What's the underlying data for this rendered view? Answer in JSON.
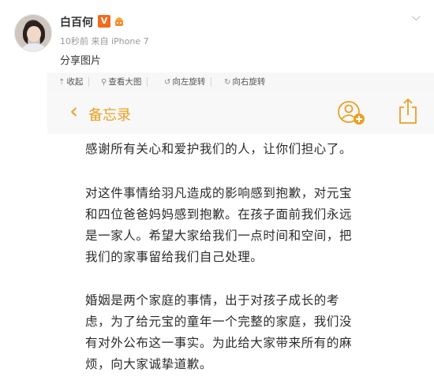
{
  "post": {
    "username": "白百何",
    "vip_badge": "V",
    "meta": "10秒前 来自 iPhone 7",
    "text": "分享图片"
  },
  "toolbar": {
    "items": [
      {
        "icon": "collapse-icon",
        "label": "收起"
      },
      {
        "icon": "zoom-icon",
        "label": "查看大图"
      },
      {
        "icon": "rotate-left-icon",
        "label": "向左旋转"
      },
      {
        "icon": "rotate-right-icon",
        "label": "向右旋转"
      }
    ]
  },
  "notes_app": {
    "back_label": "备忘录",
    "accent_color": "#e8a125",
    "paragraphs": [
      [
        "感谢所有关心和爱护我们的人，让你们担心了。"
      ],
      [
        "对这件事情给羽凡造成的影响感到抱歉，对元宝",
        "和四位爸爸妈妈感到抱歉。在孩子面前我们永远",
        "是一家人。希望大家给我们一点时间和空间，把",
        "我们的家事留给我们自己处理。"
      ],
      [
        "婚姻是两个家庭的事情，出于对孩子成长的考",
        "虑，为了给元宝的童年一个完整的家庭，我们没",
        "有对外公布这一事实。为此给大家带来所有的麻",
        "烦，向大家诚挚道歉。"
      ]
    ]
  }
}
